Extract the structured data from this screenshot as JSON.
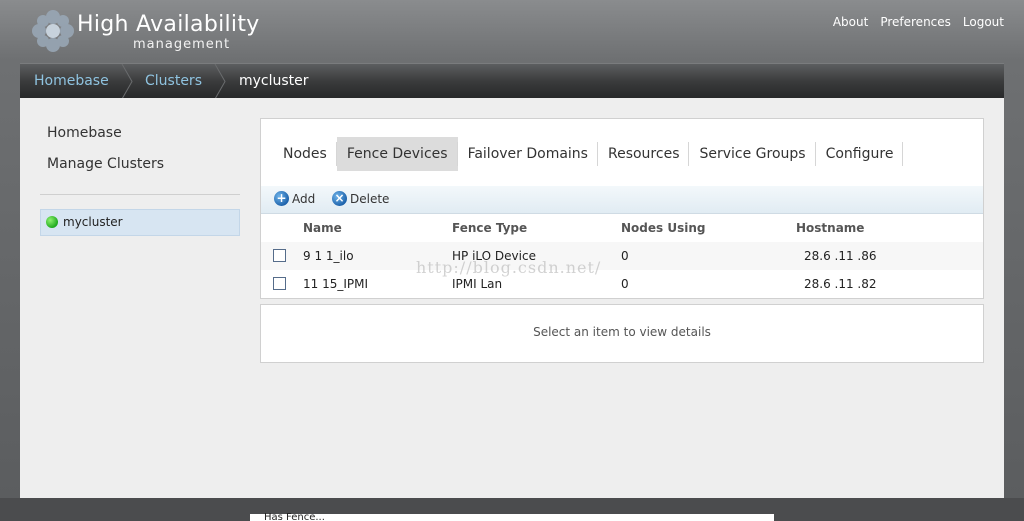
{
  "header": {
    "title": "High Availability",
    "subtitle": "management",
    "links": {
      "about": "About",
      "preferences": "Preferences",
      "logout": "Logout"
    }
  },
  "breadcrumb": {
    "home": "Homebase",
    "clusters": "Clusters",
    "current": "mycluster"
  },
  "sidebar": {
    "links": {
      "homebase": "Homebase",
      "manage": "Manage Clusters"
    },
    "cluster": {
      "name": "mycluster",
      "status_color": "#33c233"
    }
  },
  "tabs": {
    "nodes": "Nodes",
    "fence": "Fence Devices",
    "failover": "Failover Domains",
    "resources": "Resources",
    "groups": "Service Groups",
    "configure": "Configure"
  },
  "toolbar": {
    "add": "Add",
    "delete": "Delete"
  },
  "table": {
    "headers": {
      "name": "Name",
      "type": "Fence Type",
      "nodes": "Nodes Using",
      "host": "Hostname"
    },
    "rows": [
      {
        "name": "9  1  1_ilo",
        "type": "HP iLO Device",
        "nodes": "0",
        "host": "28.6 .11 .86"
      },
      {
        "name": "11  15_IPMI",
        "type": "IPMI Lan",
        "nodes": "0",
        "host": "28.6 .11 .82"
      }
    ]
  },
  "details": {
    "placeholder": "Select an item to view details"
  },
  "watermark": "http://blog.csdn.net/",
  "bottom": {
    "text": "Has Fence..."
  },
  "colors": {
    "link": "#8fc3e0",
    "active_tab": "#dcdcdc",
    "toolbar": "#e1ecf3"
  }
}
